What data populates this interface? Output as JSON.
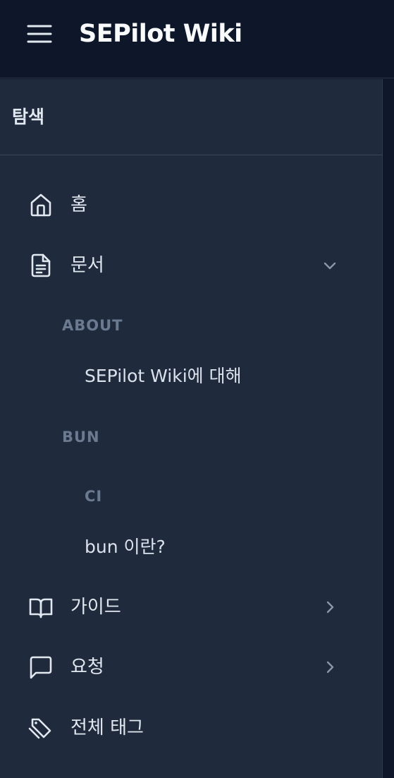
{
  "header": {
    "app_title": "SEPilot Wiki",
    "menu_icon": "hamburger-menu-icon"
  },
  "sidebar": {
    "section_title": "탐색",
    "items": [
      {
        "label": "홈",
        "icon": "home-icon"
      },
      {
        "label": "문서",
        "icon": "document-icon",
        "expanded": true
      },
      {
        "label": "가이드",
        "icon": "book-icon",
        "expanded": false
      },
      {
        "label": "요청",
        "icon": "message-icon",
        "expanded": false
      },
      {
        "label": "전체 태그",
        "icon": "tag-icon"
      }
    ],
    "documents": {
      "groups": [
        {
          "title": "ABOUT",
          "links": [
            "SEPilot Wiki에 대해"
          ]
        },
        {
          "title": "BUN",
          "subgroup": "CI",
          "links": [
            "bun 이란?"
          ]
        }
      ]
    }
  },
  "colors": {
    "topbar_bg": "#0e172a",
    "sidebar_bg": "#1f2a3c",
    "text_primary": "#e2e8f0",
    "text_muted": "#6b7a90"
  }
}
